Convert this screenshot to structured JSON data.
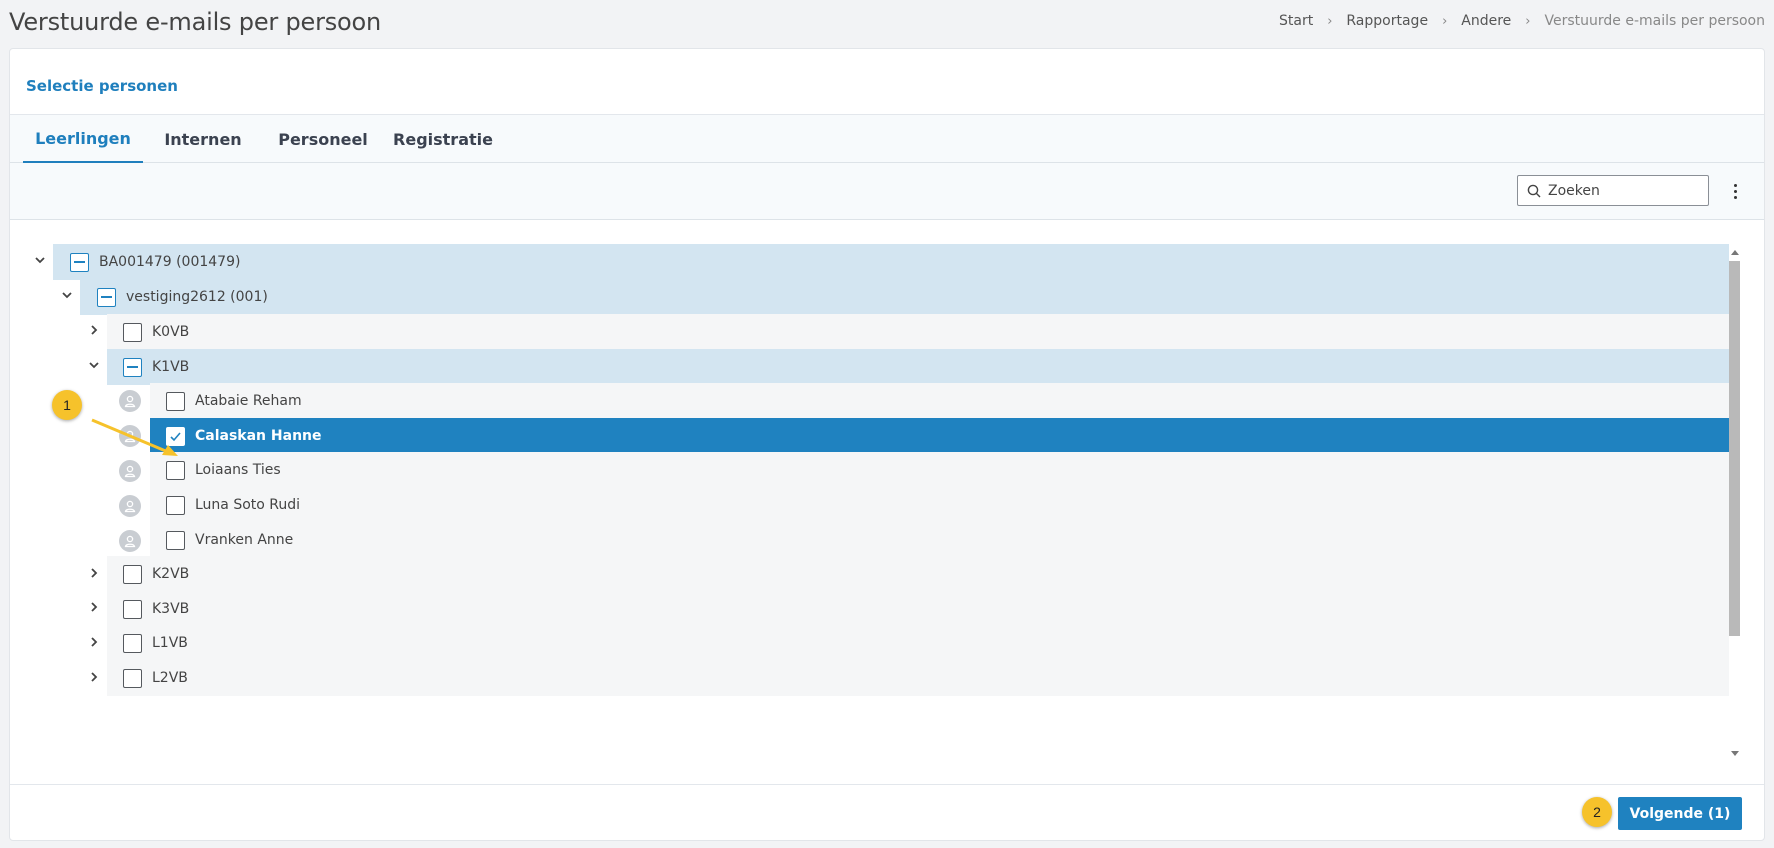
{
  "page": {
    "title": "Verstuurde e-mails per persoon"
  },
  "breadcrumb": [
    "Start",
    "Rapportage",
    "Andere",
    "Verstuurde e-mails per persoon"
  ],
  "card": {
    "title": "Selectie personen"
  },
  "tabs": [
    "Leerlingen",
    "Internen",
    "Personeel",
    "Registratie"
  ],
  "active_tab": "Leerlingen",
  "search": {
    "placeholder": "Zoeken",
    "value": ""
  },
  "tree": {
    "root": {
      "label": "BA001479 (001479)",
      "state": "partial",
      "expanded": true
    },
    "vestiging": {
      "label": "vestiging2612 (001)",
      "state": "partial",
      "expanded": true
    },
    "classes": [
      {
        "label": "K0VB",
        "state": "unchecked",
        "expanded": false
      },
      {
        "label": "K1VB",
        "state": "partial",
        "expanded": true
      },
      {
        "label": "K2VB",
        "state": "unchecked",
        "expanded": false
      },
      {
        "label": "K3VB",
        "state": "unchecked",
        "expanded": false
      },
      {
        "label": "L1VB",
        "state": "unchecked",
        "expanded": false
      },
      {
        "label": "L2VB",
        "state": "unchecked",
        "expanded": false
      }
    ],
    "students": [
      {
        "label": "Atabaie Reham",
        "checked": false
      },
      {
        "label": "Calaskan Hanne",
        "checked": true
      },
      {
        "label": "Loiaans Ties",
        "checked": false
      },
      {
        "label": "Luna Soto Rudi",
        "checked": false
      },
      {
        "label": "Vranken Anne",
        "checked": false
      }
    ]
  },
  "footer": {
    "next_label": "Volgende (1)"
  },
  "annotations": {
    "marker1": "1",
    "marker2": "2"
  },
  "colors": {
    "accent": "#1f82c0",
    "partial_bg": "#d3e5f1",
    "marker": "#f6c22b"
  }
}
